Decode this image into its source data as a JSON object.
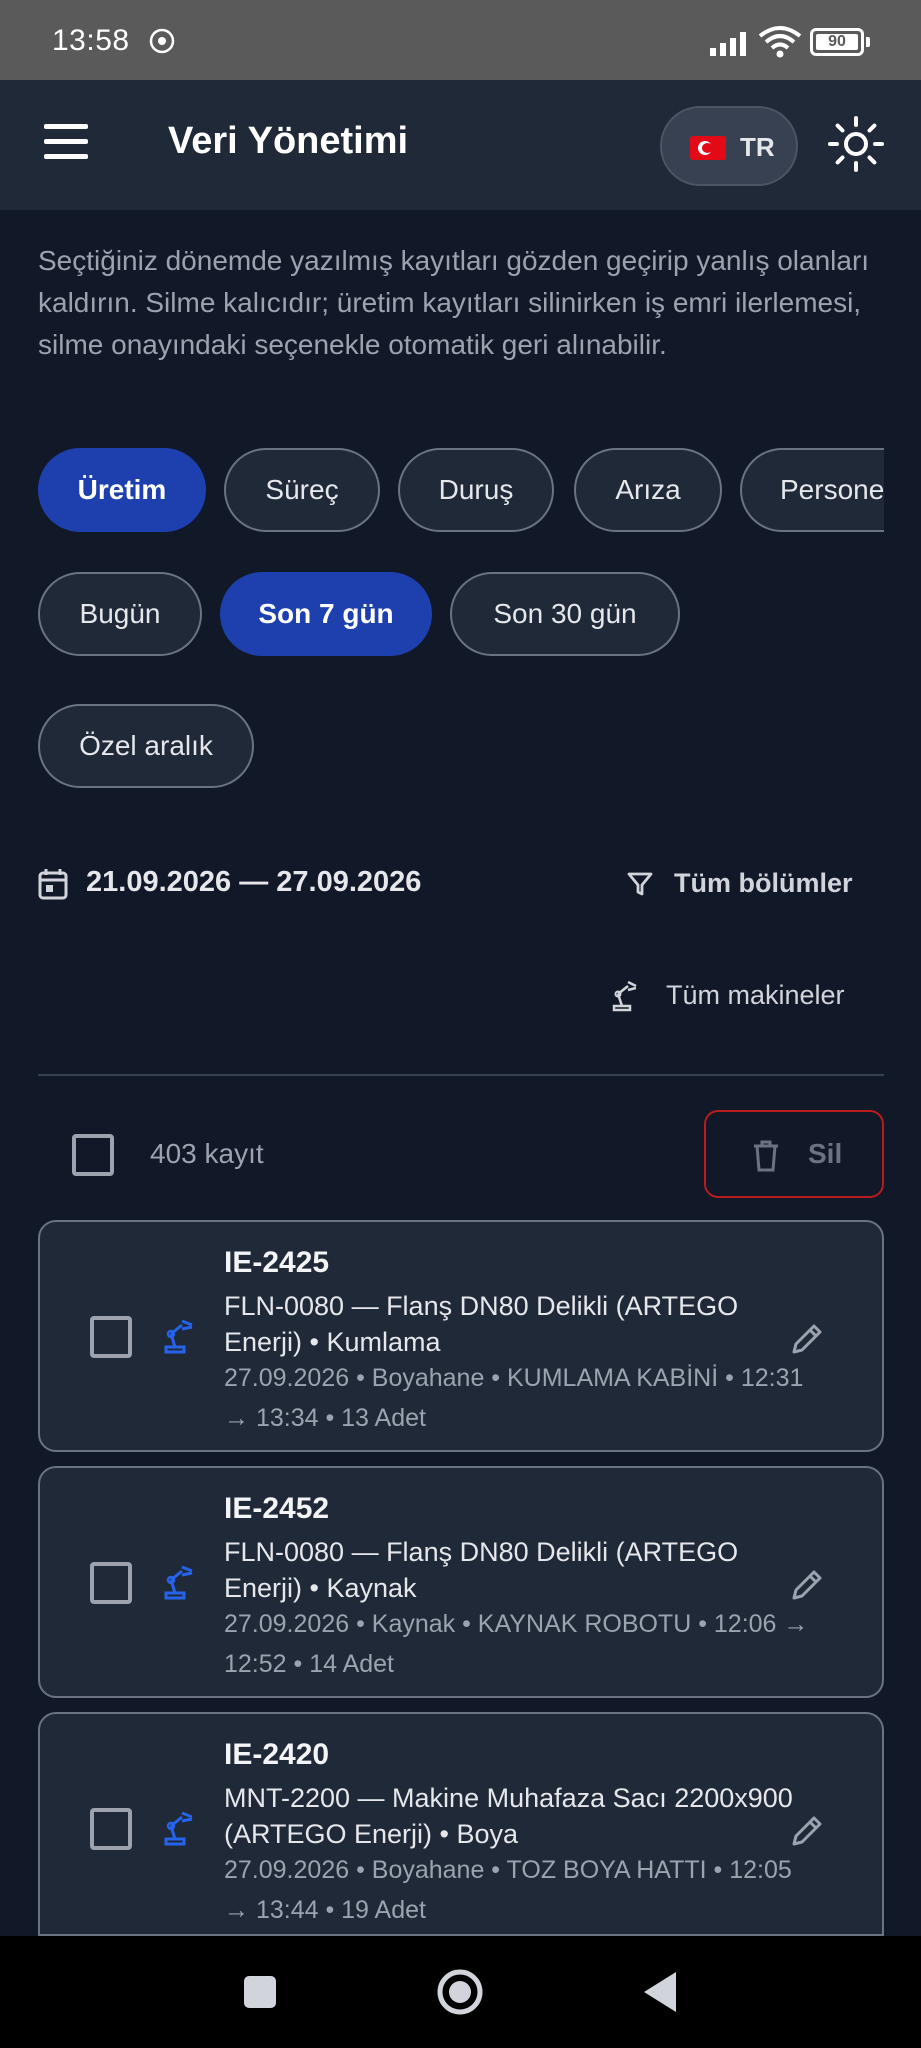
{
  "status_bar": {
    "time": "13:58",
    "battery": "90"
  },
  "app_bar": {
    "title": "Veri Yönetimi",
    "language": "TR"
  },
  "description": "Seçtiğiniz dönemde yazılmış kayıtları gözden geçirip yanlış olanları kaldırın. Silme kalıcıdır; üretim kayıtları silinirken iş emri ilerlemesi, silme onayındaki seçenekle otomatik geri alınabilir.",
  "categories": [
    {
      "label": "Üretim",
      "active": true
    },
    {
      "label": "Süreç",
      "active": false
    },
    {
      "label": "Duruş",
      "active": false
    },
    {
      "label": "Arıza",
      "active": false
    },
    {
      "label": "Personel",
      "active": false
    }
  ],
  "ranges": [
    {
      "label": "Bugün",
      "active": false
    },
    {
      "label": "Son 7 gün",
      "active": true
    },
    {
      "label": "Son 30 gün",
      "active": false
    },
    {
      "label": "Özel aralık",
      "active": false
    }
  ],
  "date_range": "21.09.2026 — 27.09.2026",
  "filters": {
    "sections": "Tüm bölümler",
    "machines": "Tüm makineler"
  },
  "selection": {
    "count": "403 kayıt",
    "delete": "Sil"
  },
  "records": [
    {
      "id": "IE-2425",
      "product": "FLN-0080 — Flanş DN80 Delikli  (ARTEGO Enerji)  •  Kumlama",
      "meta": "27.09.2026  •  Boyahane • KUMLAMA KABİNİ  •  12:31 → 13:34  •  13 Adet"
    },
    {
      "id": "IE-2452",
      "product": "FLN-0080 — Flanş DN80 Delikli  (ARTEGO Enerji)  •  Kaynak",
      "meta": "27.09.2026  •  Kaynak • KAYNAK ROBOTU  •  12:06 → 12:52  •  14 Adet"
    },
    {
      "id": "IE-2420",
      "product": "MNT-2200 — Makine Muhafaza Sacı 2200x900  (ARTEGO Enerji)  •  Boya",
      "meta": "27.09.2026  •  Boyahane • TOZ BOYA HATTI  •  12:05 → 13:44  •  19 Adet"
    }
  ],
  "colors": {
    "background": "#111827",
    "surface": "#1f2937",
    "accent": "#1e40af",
    "danger": "#b91c1c",
    "machine_icon": "#2563eb"
  },
  "icons": {
    "menu": "hamburger-icon",
    "theme": "sun-icon",
    "calendar": "calendar-icon",
    "filter": "filter-icon",
    "machine": "robot-arm-icon",
    "delete": "trash-icon",
    "edit": "pencil-icon"
  }
}
